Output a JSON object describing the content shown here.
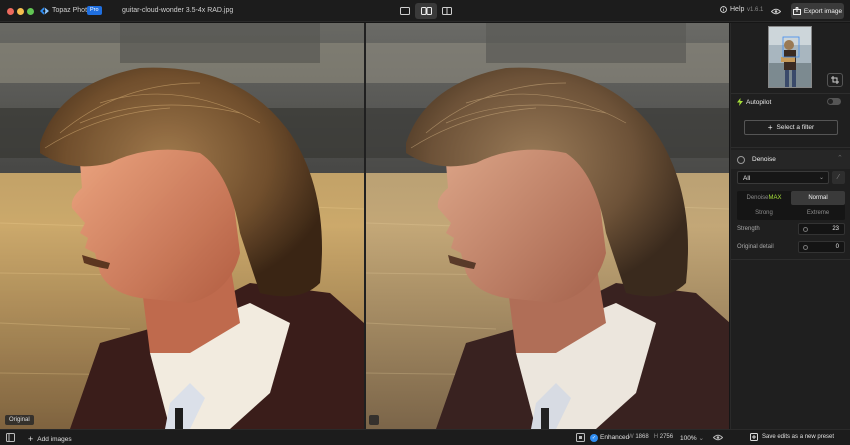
{
  "app": {
    "name": "Topaz Photo",
    "badge": "Pro",
    "version": "v1.6.1"
  },
  "file": {
    "name": "guitar-cloud-wonder 3.5-4x RAD.jpg"
  },
  "toolbar": {
    "view_modes": [
      "single-view",
      "side-by-side-view",
      "split-view"
    ],
    "active_view": "side-by-side-view",
    "help_label": "Help",
    "export_label": "Export image"
  },
  "canvas": {
    "left_label": "Original"
  },
  "panel": {
    "autopilot_label": "Autopilot",
    "autopilot_on": false,
    "select_filter_label": "Select a filter",
    "section": {
      "title": "Denoise",
      "dropdown_value": "All",
      "models": [
        {
          "label_prefix": "Denoise ",
          "label_highlight": "MAX",
          "active": false
        },
        {
          "label": "Normal",
          "active": true
        },
        {
          "label": "Strong",
          "active": false
        },
        {
          "label": "Extreme",
          "active": false
        }
      ],
      "params": [
        {
          "label": "Strength",
          "value": "23"
        },
        {
          "label": "Original detail",
          "value": "0"
        }
      ]
    },
    "save_preset_label": "Save edits as a new preset"
  },
  "bottombar": {
    "add_images_label": "Add images",
    "enhanced_label": "Enhanced",
    "width_label": "W",
    "width_value": "1868",
    "height_label": "H",
    "height_value": "2756",
    "zoom_label": "100%"
  },
  "colors": {
    "accent_blue": "#2f8cf0",
    "max_green": "#a7e03a",
    "autopilot_green": "#a7e03a"
  }
}
